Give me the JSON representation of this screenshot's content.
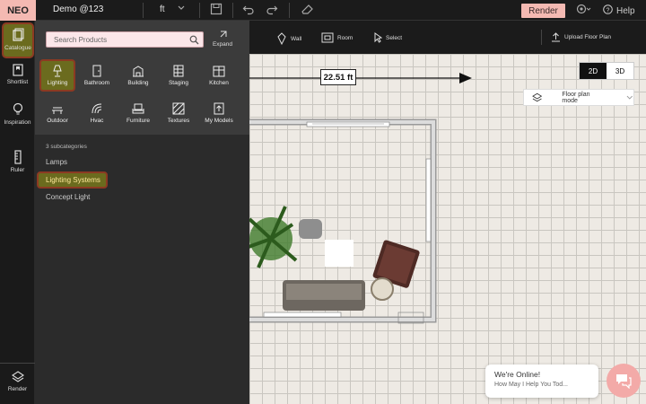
{
  "topbar": {
    "logo": "NEO",
    "project_name": "Demo @123",
    "unit": "ft",
    "render_label": "Render",
    "help_label": "Help"
  },
  "rail": {
    "items": [
      {
        "label": "Catalogue",
        "icon": "catalogue-icon",
        "active": true
      },
      {
        "label": "Shortlist",
        "icon": "shortlist-icon"
      },
      {
        "label": "Inspiration",
        "icon": "bulb-icon"
      },
      {
        "label": "Ruler",
        "icon": "ruler-icon"
      },
      {
        "label": "Render",
        "icon": "render-icon"
      }
    ]
  },
  "panel": {
    "search_placeholder": "Search Products",
    "expand_label": "Expand",
    "categories": [
      {
        "label": "Lighting",
        "icon": "lamp-icon",
        "active": true
      },
      {
        "label": "Bathroom",
        "icon": "door-icon"
      },
      {
        "label": "Building",
        "icon": "building-icon"
      },
      {
        "label": "Staging",
        "icon": "shelf-icon"
      },
      {
        "label": "Kitchen",
        "icon": "kitchen-icon"
      },
      {
        "label": "Outdoor",
        "icon": "outdoor-icon"
      },
      {
        "label": "Hvac",
        "icon": "hvac-icon"
      },
      {
        "label": "Furniture",
        "icon": "sofa-icon"
      },
      {
        "label": "Textures",
        "icon": "textures-icon"
      },
      {
        "label": "My Models",
        "icon": "upload-icon"
      }
    ],
    "subcount": "3 subcategories",
    "subcategories": [
      "Lamps",
      "Lighting Systems",
      "Concept Light"
    ]
  },
  "toolbar": {
    "wall": "Wall",
    "room": "Room",
    "select": "Select",
    "upload": "Upload Floor Plan"
  },
  "canvas": {
    "measure": "22.51 ft",
    "view_2d": "2D",
    "view_3d": "3D",
    "mode_label": "Floor plan mode"
  },
  "chat": {
    "title": "We're Online!",
    "subtitle": "How May I Help You Tod..."
  }
}
